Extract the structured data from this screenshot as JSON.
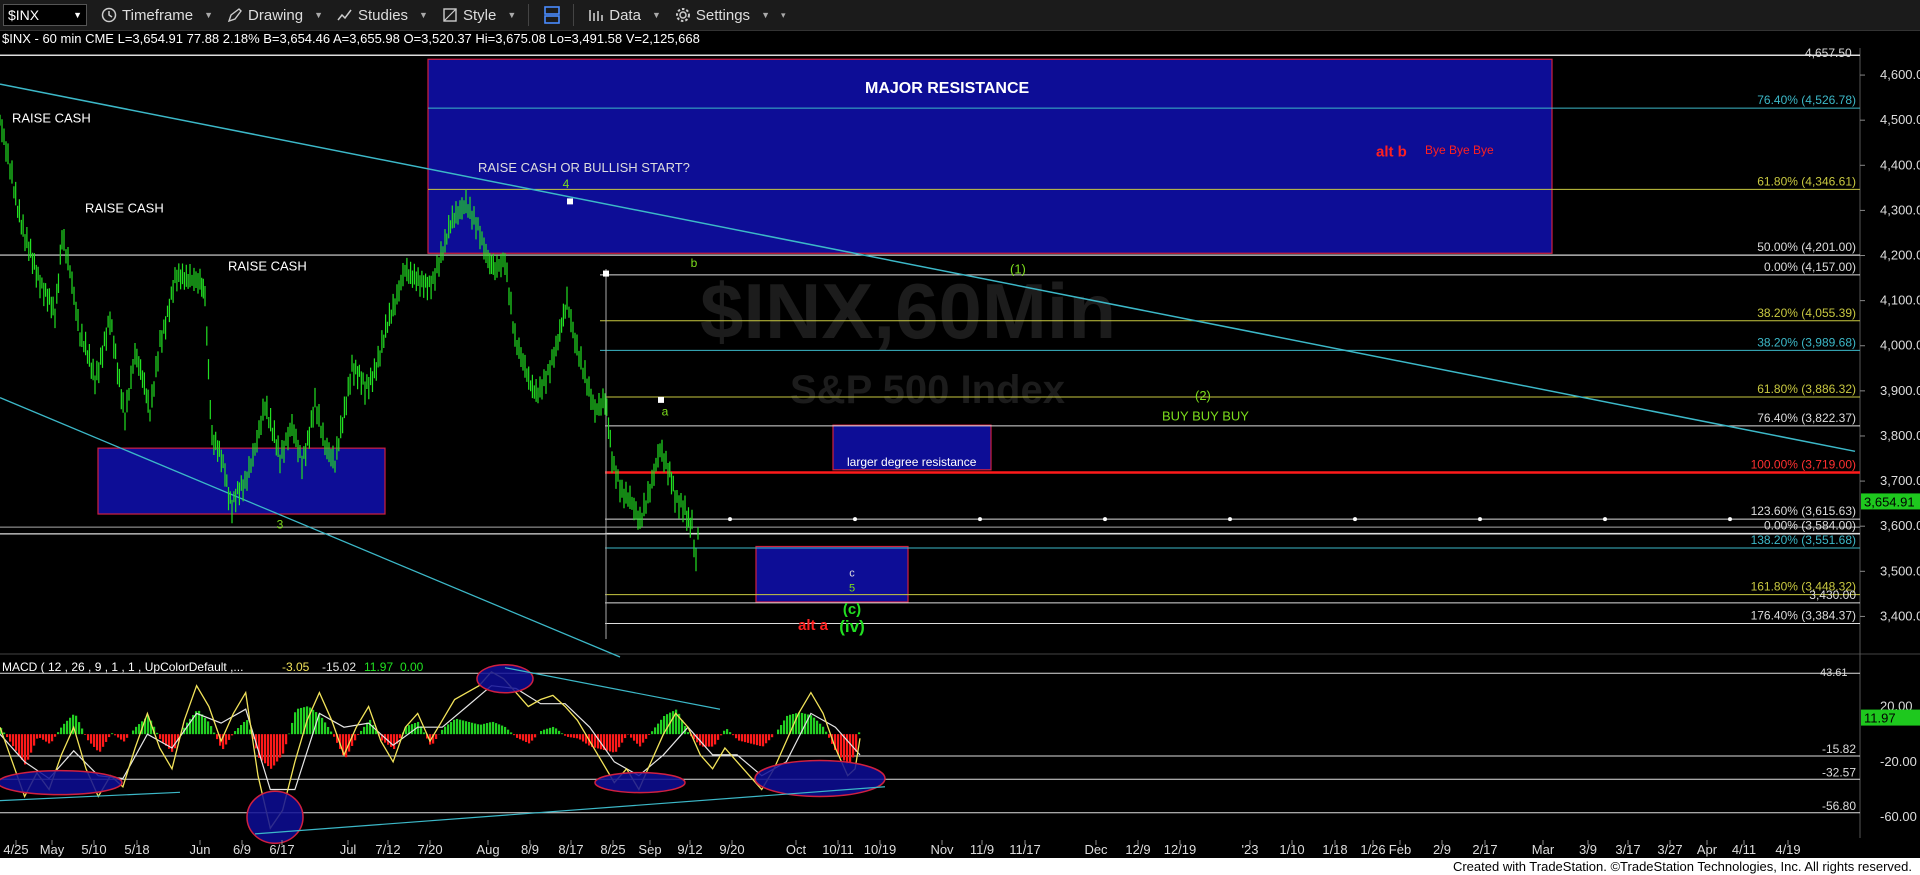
{
  "toolbar": {
    "symbol": "$INX",
    "timeframe": "Timeframe",
    "drawing": "Drawing",
    "studies": "Studies",
    "style": "Style",
    "data": "Data",
    "settings": "Settings"
  },
  "header": {
    "info": "$INX - 60 min CME  L=3,654.91 77.88 2.18% B=3,654.46 A=3,655.98 O=3,520.37 Hi=3,675.08 Lo=3,491.58 V=2,125,668"
  },
  "watermark": {
    "symbol": "$INX,60Min",
    "name": "S&P 500 Index"
  },
  "footer": {
    "text": "Created with TradeStation. ©TradeStation Technologies, Inc. All rights reserved."
  },
  "colors": {
    "price": "#22e022",
    "resistance_box": "#0d0d96",
    "box_border": "#d02040",
    "trend": "#3cb8c8",
    "red_line": "#ff1a1a",
    "macd": "#f2e35a",
    "signal": "#e6e6e6"
  },
  "chart_data": [
    {
      "type": "line",
      "panel": "price",
      "ylim": [
        3330,
        4660
      ],
      "y_ticks": [
        "3,400.00",
        "3,500.00",
        "3,600.00",
        "3,700.00",
        "3,800.00",
        "3,900.00",
        "4,000.00",
        "4,100.00",
        "4,200.00",
        "4,300.00",
        "4,400.00",
        "4,500.00",
        "4,600.00"
      ],
      "x_ticks": [
        "4/25",
        "May",
        "5/10",
        "5/18",
        "Jun",
        "6/9",
        "6/17",
        "Jul",
        "7/12",
        "7/20",
        "Aug",
        "8/9",
        "8/17",
        "8/25",
        "Sep",
        "9/12",
        "9/20",
        "Oct",
        "10/11",
        "10/19",
        "Nov",
        "11/9",
        "11/17",
        "Dec",
        "12/9",
        "12/19",
        "'23",
        "1/10",
        "1/18",
        "1/26",
        "Feb",
        "2/9",
        "2/17",
        "Mar",
        "3/9",
        "3/17",
        "3/27",
        "Apr",
        "4/11",
        "4/19"
      ],
      "series": [
        {
          "values": [
            [
              0,
              4500
            ],
            [
              12,
              4380
            ],
            [
              25,
              4230
            ],
            [
              40,
              4150
            ],
            [
              55,
              4060
            ],
            [
              62,
              4250
            ],
            [
              70,
              4170
            ],
            [
              80,
              4020
            ],
            [
              95,
              3930
            ],
            [
              110,
              4050
            ],
            [
              125,
              3850
            ],
            [
              135,
              3990
            ],
            [
              150,
              3850
            ],
            [
              160,
              4010
            ],
            [
              175,
              4140
            ],
            [
              190,
              4160
            ],
            [
              200,
              4150
            ],
            [
              205,
              4100
            ],
            [
              212,
              3800
            ],
            [
              225,
              3720
            ],
            [
              232,
              3640
            ],
            [
              245,
              3700
            ],
            [
              255,
              3780
            ],
            [
              265,
              3880
            ],
            [
              280,
              3740
            ],
            [
              292,
              3820
            ],
            [
              302,
              3740
            ],
            [
              315,
              3870
            ],
            [
              325,
              3770
            ],
            [
              335,
              3730
            ],
            [
              352,
              3960
            ],
            [
              365,
              3900
            ],
            [
              380,
              3980
            ],
            [
              395,
              4100
            ],
            [
              405,
              4180
            ],
            [
              420,
              4130
            ],
            [
              433,
              4150
            ],
            [
              445,
              4230
            ],
            [
              456,
              4290
            ],
            [
              466,
              4320
            ],
            [
              478,
              4270
            ],
            [
              488,
              4200
            ],
            [
              495,
              4160
            ],
            [
              505,
              4180
            ],
            [
              515,
              4010
            ],
            [
              525,
              3950
            ],
            [
              538,
              3890
            ],
            [
              548,
              3930
            ],
            [
              558,
              4000
            ],
            [
              567,
              4110
            ],
            [
              575,
              4020
            ],
            [
              585,
              3940
            ],
            [
              595,
              3860
            ],
            [
              605,
              3880
            ],
            [
              612,
              3750
            ],
            [
              622,
              3680
            ],
            [
              630,
              3670
            ],
            [
              640,
              3620
            ],
            [
              650,
              3690
            ],
            [
              660,
              3780
            ],
            [
              668,
              3730
            ],
            [
              675,
              3660
            ],
            [
              685,
              3640
            ],
            [
              692,
              3600
            ],
            [
              696,
              3510
            ],
            [
              700,
              3660
            ]
          ]
        }
      ],
      "fib_levels": [
        {
          "label": "76.40% (4,526.78)",
          "value": 4526.78
        },
        {
          "label": "61.80% (4,346.61)",
          "value": 4346.61
        },
        {
          "label": "50.00% (4,201.00)",
          "value": 4201
        },
        {
          "label": "0.00% (4,157.00)",
          "value": 4157
        },
        {
          "label": "38.20% (4,055.39)",
          "value": 4055.39
        },
        {
          "label": "38.20% (3,989.68)",
          "value": 3989.68
        },
        {
          "label": "61.80% (3,886.32)",
          "value": 3886.32
        },
        {
          "label": "76.40% (3,822.37)",
          "value": 3822.37
        },
        {
          "label": "100.00% (3,719.00)",
          "value": 3719
        },
        {
          "label": "123.60% (3,615.63)",
          "value": 3615.63
        },
        {
          "label": "0.00% (3,584.00)",
          "value": 3584
        },
        {
          "label": "138.20% (3,551.68)",
          "value": 3551.68
        },
        {
          "label": "161.80% (3,448.32)",
          "value": 3448.32
        },
        {
          "label": "3,430.00",
          "value": 3430
        },
        {
          "label": "176.40% (3,384.37)",
          "value": 3384.37
        }
      ],
      "last_price": "3,654.91",
      "top_cut_label": "4,657.50",
      "annotations": {
        "major_resistance": "MAJOR RESISTANCE",
        "raise_cash_1": "RAISE CASH",
        "raise_cash_2": "RAISE CASH",
        "raise_cash_3": "RAISE CASH",
        "raise_cash_bullish": "RAISE CASH OR BULLISH START?",
        "alt_b": "alt b",
        "bye": "Bye Bye Bye",
        "larger_degree": "larger degree resistance",
        "buy": "BUY BUY BUY",
        "wave_1": "(1)",
        "wave_2": "(2)",
        "wave_4": "4",
        "wave_b": "b",
        "wave_a": "a",
        "wave_3": "3",
        "wave_c_small": "c",
        "wave_5": "5",
        "wave_c": "(c)",
        "wave_iv": "(iv)",
        "alt_a": "alt a"
      }
    },
    {
      "type": "line",
      "panel": "macd",
      "title": "MACD ( 12 , 26 , 9 , 1 , 1 , UpColorDefault ,...",
      "values_label": {
        "macd": "-3.05",
        "signal": "-15.02",
        "hist": "11.97",
        "zero": "0.00"
      },
      "ylim": [
        -75,
        55
      ],
      "y_ticks": [
        "20.00",
        "-20.00",
        "-60.00"
      ],
      "level_labels": [
        "-15.82",
        "-32.57",
        "-56.80"
      ],
      "last_value": "11.97",
      "top_cut_label": "43.61",
      "series": [
        {
          "name": "MACD",
          "values": [
            [
              0,
              5
            ],
            [
              10,
              -20
            ],
            [
              20,
              -45
            ],
            [
              30,
              -28
            ],
            [
              40,
              -40
            ],
            [
              50,
              -15
            ],
            [
              60,
              5
            ],
            [
              70,
              -25
            ],
            [
              80,
              -45
            ],
            [
              90,
              -30
            ],
            [
              100,
              -38
            ],
            [
              110,
              -10
            ],
            [
              120,
              15
            ],
            [
              130,
              -10
            ],
            [
              140,
              -25
            ],
            [
              150,
              10
            ],
            [
              160,
              35
            ],
            [
              170,
              20
            ],
            [
              180,
              -5
            ],
            [
              190,
              15
            ],
            [
              200,
              30
            ],
            [
              210,
              -30
            ],
            [
              220,
              -68
            ],
            [
              230,
              -55
            ],
            [
              240,
              -20
            ],
            [
              250,
              10
            ],
            [
              260,
              30
            ],
            [
              270,
              10
            ],
            [
              280,
              -15
            ],
            [
              290,
              5
            ],
            [
              300,
              20
            ],
            [
              310,
              -5
            ],
            [
              320,
              -20
            ],
            [
              330,
              5
            ],
            [
              340,
              15
            ],
            [
              350,
              -5
            ],
            [
              360,
              10
            ],
            [
              370,
              25
            ],
            [
              380,
              30
            ],
            [
              390,
              35
            ],
            [
              400,
              45
            ],
            [
              410,
              40
            ],
            [
              420,
              30
            ],
            [
              430,
              20
            ],
            [
              440,
              25
            ],
            [
              450,
              28
            ],
            [
              460,
              20
            ],
            [
              470,
              10
            ],
            [
              480,
              -5
            ],
            [
              490,
              -20
            ],
            [
              500,
              -35
            ],
            [
              510,
              -25
            ],
            [
              520,
              -40
            ],
            [
              530,
              -20
            ],
            [
              540,
              0
            ],
            [
              550,
              15
            ],
            [
              560,
              5
            ],
            [
              570,
              -15
            ],
            [
              580,
              -25
            ],
            [
              590,
              -10
            ],
            [
              600,
              -20
            ],
            [
              610,
              -30
            ],
            [
              620,
              -40
            ],
            [
              630,
              -25
            ],
            [
              640,
              -5
            ],
            [
              650,
              15
            ],
            [
              660,
              30
            ],
            [
              670,
              15
            ],
            [
              680,
              -10
            ],
            [
              690,
              -30
            ],
            [
              696,
              -25
            ],
            [
              700,
              -3
            ]
          ]
        },
        {
          "name": "Signal",
          "values": [
            [
              0,
              0
            ],
            [
              20,
              -20
            ],
            [
              40,
              -32
            ],
            [
              60,
              -12
            ],
            [
              80,
              -30
            ],
            [
              100,
              -32
            ],
            [
              120,
              0
            ],
            [
              140,
              -10
            ],
            [
              160,
              15
            ],
            [
              180,
              8
            ],
            [
              200,
              18
            ],
            [
              220,
              -40
            ],
            [
              240,
              -40
            ],
            [
              260,
              15
            ],
            [
              280,
              5
            ],
            [
              300,
              8
            ],
            [
              320,
              -8
            ],
            [
              340,
              5
            ],
            [
              360,
              5
            ],
            [
              380,
              20
            ],
            [
              400,
              35
            ],
            [
              420,
              33
            ],
            [
              440,
              22
            ],
            [
              460,
              22
            ],
            [
              480,
              5
            ],
            [
              500,
              -20
            ],
            [
              520,
              -30
            ],
            [
              540,
              -15
            ],
            [
              560,
              5
            ],
            [
              580,
              -15
            ],
            [
              600,
              -15
            ],
            [
              620,
              -30
            ],
            [
              640,
              -20
            ],
            [
              660,
              15
            ],
            [
              680,
              5
            ],
            [
              700,
              -15
            ]
          ]
        }
      ]
    }
  ]
}
